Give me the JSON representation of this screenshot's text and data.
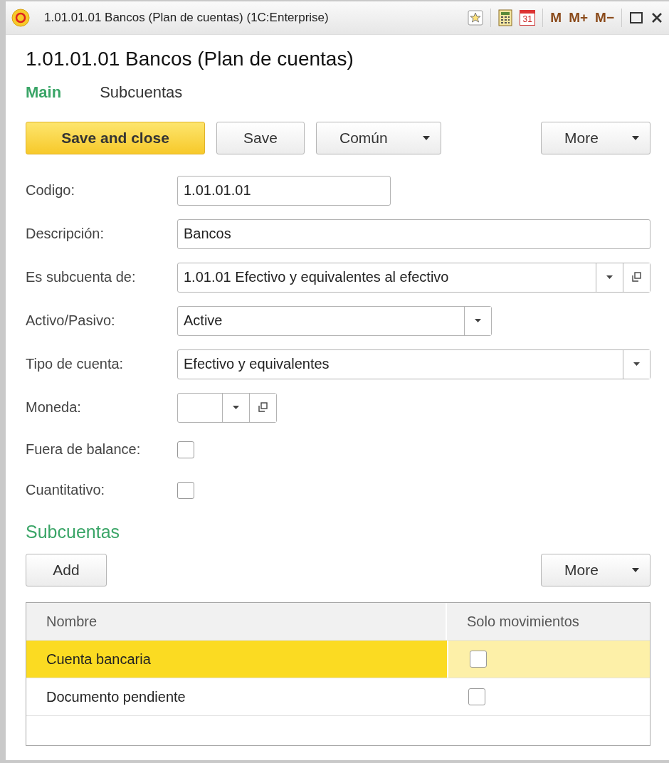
{
  "window": {
    "title": "1.01.01.01 Bancos (Plan de cuentas)  (1C:Enterprise)",
    "calendar_day": "31",
    "memory_buttons": [
      "M",
      "M+",
      "M−"
    ]
  },
  "heading": "1.01.01.01 Bancos (Plan de cuentas)",
  "tabs": [
    {
      "label": "Main",
      "selected": true
    },
    {
      "label": "Subcuentas",
      "selected": false
    }
  ],
  "toolbar": {
    "buttons": [
      {
        "label": "Save and close",
        "kind": "primary"
      },
      {
        "label": "Save",
        "kind": "plain"
      },
      {
        "label": "Común",
        "kind": "menu"
      }
    ],
    "more": "More"
  },
  "fields": [
    {
      "label": "Codigo:",
      "kind": "text",
      "value": "1.01.01.01"
    },
    {
      "label": "Descripción:",
      "kind": "text",
      "value": "Bancos"
    },
    {
      "label": "Es subcuenta de:",
      "kind": "select_open",
      "value": "1.01.01 Efectivo y equivalentes al efectivo"
    },
    {
      "label": "Activo/Pasivo:",
      "kind": "select",
      "value": "Active"
    },
    {
      "label": "Tipo de cuenta:",
      "kind": "select",
      "value": "Efectivo y equivalentes"
    },
    {
      "label": "Moneda:",
      "kind": "select_open"
    },
    {
      "label": "Fuera de balance:",
      "kind": "checkbox",
      "checked": false
    },
    {
      "label": "Cuantitativo:",
      "kind": "checkbox",
      "checked": false
    }
  ],
  "subcuentas": {
    "title": "Subcuentas",
    "add": "Add",
    "more": "More",
    "table": {
      "columns": [
        "Nombre",
        "Solo movimientos"
      ],
      "rows": [
        {
          "nombre": "Cuenta bancaria",
          "solo_movimientos": false,
          "selected": true
        },
        {
          "nombre": "Documento pendiente",
          "solo_movimientos": false,
          "selected": false
        }
      ]
    }
  }
}
